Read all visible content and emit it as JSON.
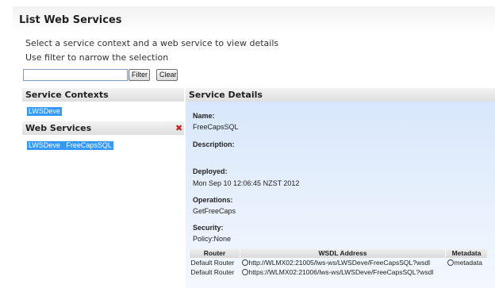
{
  "page": {
    "title": "List Web Services",
    "hint_line1": "Select a service context and a web service to view details",
    "hint_line2": "Use filter to narrow the selection"
  },
  "filter": {
    "value": "",
    "filter_button": "Filter",
    "clear_button": "Clear"
  },
  "service_contexts": {
    "header": "Service Contexts",
    "items": [
      "LWSDeve"
    ]
  },
  "web_services": {
    "header": "Web Services",
    "items": [
      "LWSDeve   FreeCapsSQL"
    ],
    "remove_icon": "close-icon"
  },
  "details": {
    "header": "Service Details",
    "name_label": "Name:",
    "name_value": "FreeCapsSQL",
    "description_label": "Description:",
    "description_value": "",
    "deployed_label": "Deployed:",
    "deployed_value": "Mon Sep 10 12:06:45 NZST 2012",
    "operations_label": "Operations:",
    "operations_value": "GetFreeCaps",
    "security_label": "Security:",
    "security_value": "Policy:None",
    "table": {
      "columns": [
        "Router",
        "WSDL Address",
        "Metadata"
      ],
      "rows": [
        {
          "router": "Default Router",
          "wsdl": "http://WLMX02:21005/lws-ws/LWSDeve/FreeCapsSQL?wsdl",
          "metadata": "metadata"
        },
        {
          "router": "Default Router",
          "wsdl": "https://WLMX02:21006/lws-ws/LWSDeve/FreeCapsSQL?wsdl",
          "metadata": ""
        }
      ]
    }
  },
  "colors": {
    "selection": "#3399ff",
    "details_bg": "#d8e7fb",
    "remove_icon": "#cc1f1f"
  }
}
